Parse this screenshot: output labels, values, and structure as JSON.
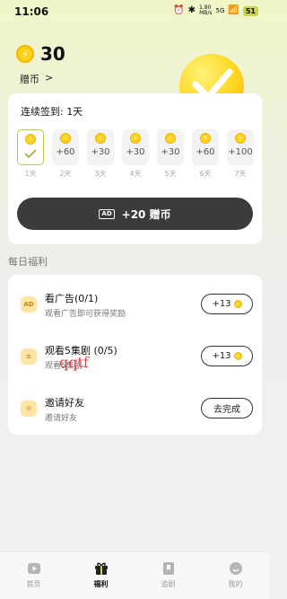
{
  "status_bar": {
    "time": "11:06",
    "net_speed_top": "1.80",
    "net_speed_bottom": "MB/s",
    "network": "5G",
    "battery": "51"
  },
  "header": {
    "balance": "30",
    "coin_label": "赠币",
    "coin_label_arrow": ">"
  },
  "signin": {
    "title": "连续签到: 1天",
    "days": [
      {
        "amount": "",
        "label": "1天",
        "signed": true
      },
      {
        "amount": "+60",
        "label": "2天",
        "signed": false
      },
      {
        "amount": "+30",
        "label": "3天",
        "signed": false
      },
      {
        "amount": "+30",
        "label": "4天",
        "signed": false
      },
      {
        "amount": "+30",
        "label": "5天",
        "signed": false
      },
      {
        "amount": "+60",
        "label": "6天",
        "signed": false
      },
      {
        "amount": "+100",
        "label": "7天",
        "signed": false
      }
    ],
    "ad_tag": "AD",
    "ad_button_label": "+20 赠币"
  },
  "daily": {
    "section_title": "每日福利",
    "tasks": [
      {
        "name": "看广告(0/1)",
        "desc": "观看广告即可获得奖励",
        "button": "+13",
        "icon": "ad-icon"
      },
      {
        "name": "观看5集剧 (0/5)",
        "desc": "观看5集剧",
        "button": "+13",
        "icon": "stack-icon"
      },
      {
        "name": "邀请好友",
        "desc": "邀请好友",
        "button": "去完成",
        "icon": "mail-icon"
      }
    ],
    "watermark": "qqtf"
  },
  "tabbar": {
    "items": [
      {
        "label": "首页",
        "icon": "play-icon",
        "active": false
      },
      {
        "label": "福利",
        "icon": "gift-icon",
        "active": true
      },
      {
        "label": "追剧",
        "icon": "bookmark-icon",
        "active": false
      },
      {
        "label": "我的",
        "icon": "profile-icon",
        "active": false
      }
    ]
  },
  "colors": {
    "accent_green": "#b7c94a",
    "coin_yellow": "#ffd21a",
    "dark_button": "#3b3b3b"
  }
}
